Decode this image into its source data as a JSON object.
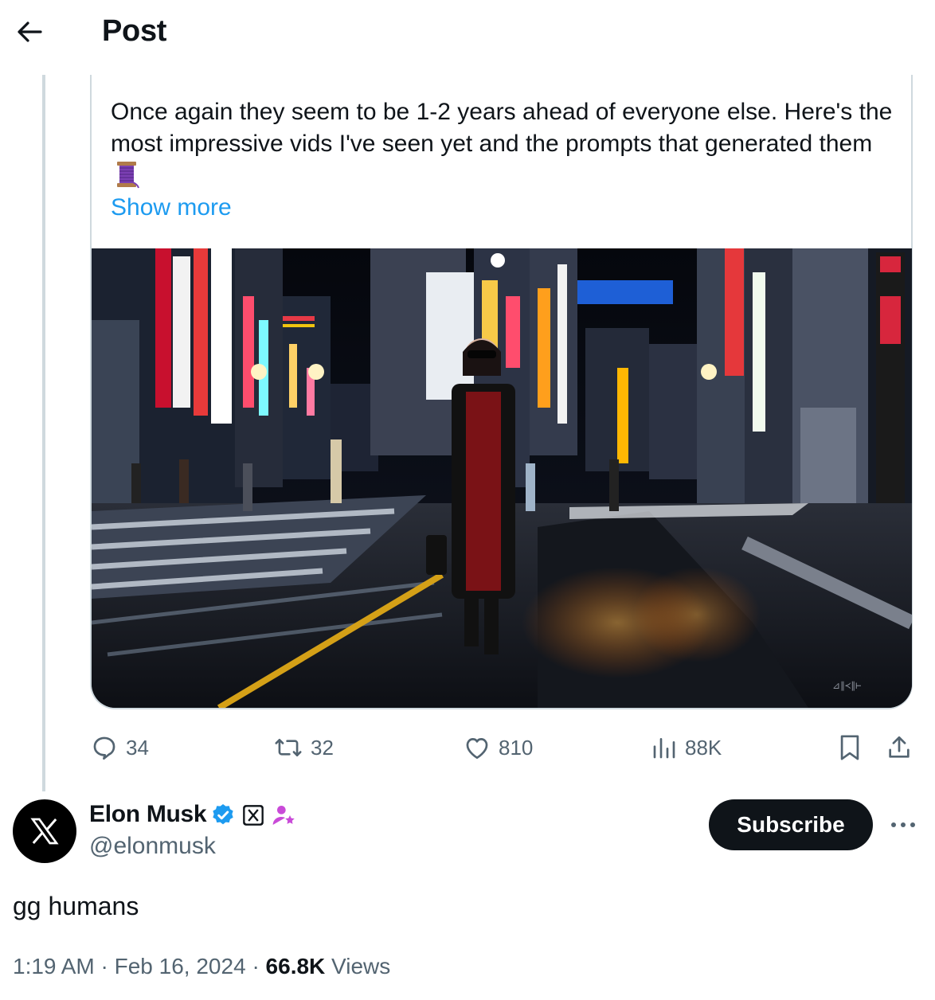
{
  "header": {
    "title": "Post"
  },
  "quoted_post": {
    "text": "Once again they seem to be 1-2 years ahead of everyone else. Here's the most impressive vids I've seen yet and the prompts that generated them",
    "show_more_label": "Show more"
  },
  "media_watermark": "⊿∥≺∥⊢",
  "actions": {
    "replies": "34",
    "reposts": "32",
    "likes": "810",
    "views": "88K"
  },
  "author": {
    "name": "Elon Musk",
    "handle": "@elonmusk",
    "subscribe_label": "Subscribe"
  },
  "post": {
    "text": "gg humans",
    "time": "1:19 AM",
    "separator": "·",
    "date": "Feb 16, 2024",
    "views_count": "66.8K",
    "views_label": "Views"
  },
  "colors": {
    "link": "#1d9bf0",
    "muted": "#536471",
    "verified": "#1d9bf0",
    "affiliate": "#c94ad8"
  }
}
